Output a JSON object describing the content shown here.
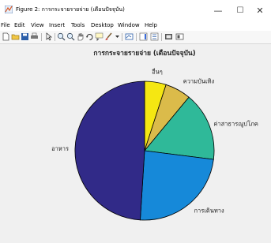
{
  "window": {
    "title": "Figure 2: การกระจายรายจ่าย (เดือนปัจจุบัน)",
    "controls": {
      "minimize": "—",
      "maximize": "☐",
      "close": "✕"
    }
  },
  "menu": {
    "items": [
      "File",
      "Edit",
      "View",
      "Insert",
      "Tools",
      "Desktop",
      "Window",
      "Help"
    ]
  },
  "toolbar": {
    "icons": [
      "new-figure-icon",
      "open-file-icon",
      "save-icon",
      "print-icon",
      "pointer-icon",
      "zoom-in-icon",
      "zoom-out-icon",
      "pan-icon",
      "rotate-3d-icon",
      "data-cursor-icon",
      "brush-icon",
      "link-plot-icon",
      "insert-colorbar-icon",
      "insert-legend-icon",
      "hide-plot-tools-icon",
      "show-plot-tools-icon"
    ]
  },
  "chart_data": {
    "type": "pie",
    "title": "การกระจายรายจ่าย (เดือนปัจจุบัน)",
    "categories": [
      "อื่นๆ",
      "ความบันเทิง",
      "ค่าสาธารณูปโภค",
      "การเดินทาง",
      "อาหาร"
    ],
    "values": [
      5,
      6,
      16,
      24,
      49
    ],
    "unit": "percent",
    "colors": [
      "#f5e712",
      "#dbbb4a",
      "#2fb999",
      "#1689d9",
      "#312a88"
    ],
    "start": "12 o'clock",
    "direction": "clockwise",
    "legend": "none"
  }
}
